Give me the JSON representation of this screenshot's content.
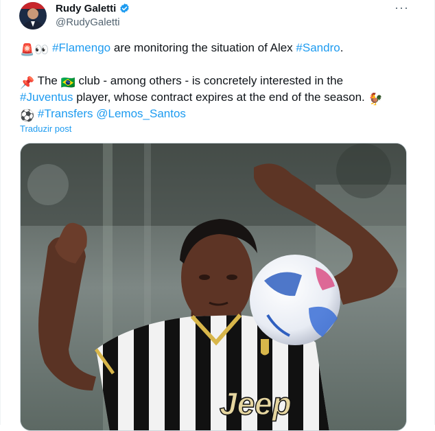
{
  "author": {
    "name": "Rudy Galetti",
    "handle": "@RudyGaletti",
    "verified": true,
    "avatar_icon": "avatar-photo"
  },
  "more_menu": "···",
  "tweet": {
    "line1": {
      "emoji1": "🚨",
      "emoji2": "👀",
      "hashtag1": "#Flamengo",
      "text1": " are monitoring the situation of Alex ",
      "hashtag2": "#Sandro",
      "text2": "."
    },
    "line2": {
      "emoji_pin": "📌",
      "text1": " The ",
      "emoji_flag": "🇧🇷",
      "text2": " club - among others - is concretely interested in the"
    },
    "line3": {
      "hashtag": "#Juventus",
      "text": " player, whose contract expires at the end of the season. ",
      "emoji_rooster": "🐓"
    },
    "line4": {
      "emoji_ball": "⚽",
      "hashtag": "#Transfers",
      "mention": "@Lemos_Santos"
    }
  },
  "translate_label": "Traduzir post",
  "media": {
    "description_icon": "football-player-photo",
    "jersey_text": "Jeep"
  },
  "colors": {
    "link": "#1d9bf0",
    "text": "#0f1419",
    "muted": "#536471",
    "verified": "#1d9bf0"
  }
}
